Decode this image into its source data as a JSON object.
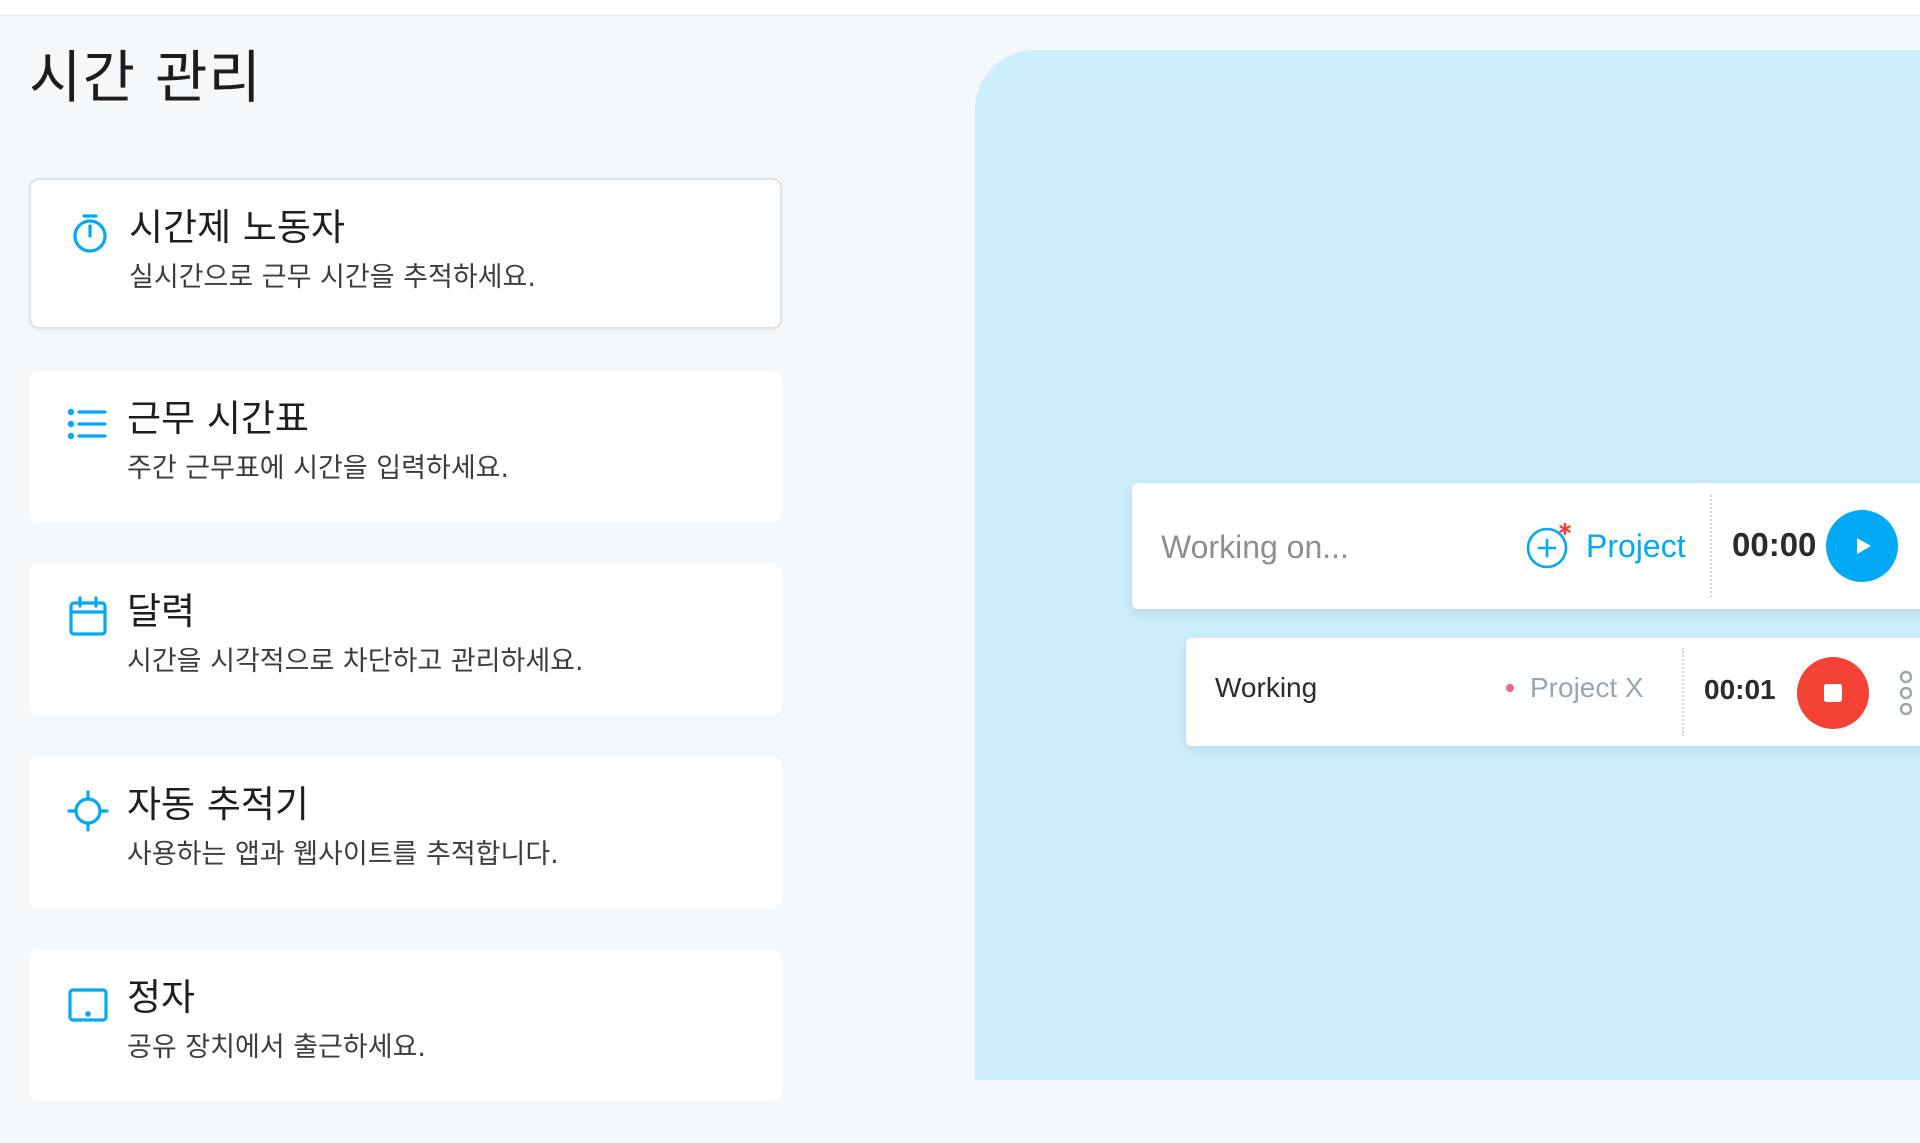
{
  "page": {
    "title": "시간 관리"
  },
  "features": [
    {
      "icon": "stopwatch-icon",
      "title": "시간제 노동자",
      "description": "실시간으로 근무 시간을 추적하세요.",
      "selected": true
    },
    {
      "icon": "list-icon",
      "title": "근무 시간표",
      "description": "주간 근무표에 시간을 입력하세요.",
      "selected": false
    },
    {
      "icon": "calendar-icon",
      "title": "달력",
      "description": "시간을 시각적으로 차단하고 관리하세요.",
      "selected": false
    },
    {
      "icon": "crosshair-icon",
      "title": "자동 추적기",
      "description": "사용하는 앱과 웹사이트를 추적합니다.",
      "selected": false
    },
    {
      "icon": "tablet-icon",
      "title": "정자",
      "description": "공유 장치에서 출근하세요.",
      "selected": false
    }
  ],
  "tracker": {
    "placeholder": "Working on...",
    "project_label": "Project",
    "timer": "00:00"
  },
  "entry": {
    "description": "Working",
    "project": "Project X",
    "timer": "00:01"
  },
  "colors": {
    "accent": "#03a9f4",
    "stop": "#f44336",
    "project_dot": "#f06292",
    "preview_bg": "#cdeefd"
  }
}
